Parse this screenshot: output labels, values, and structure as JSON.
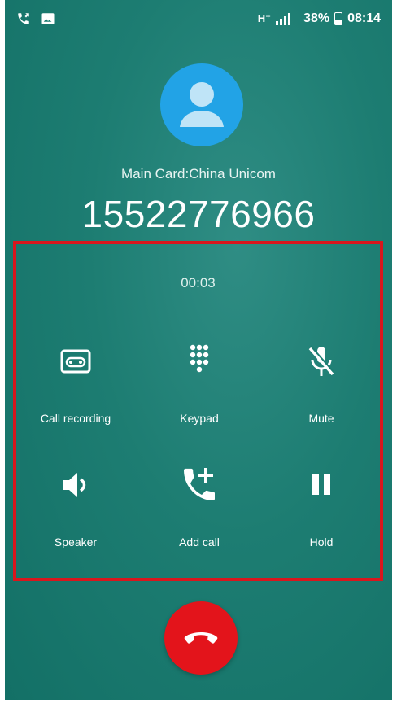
{
  "status_bar": {
    "network": "H⁺",
    "battery_percent": "38%",
    "time": "08:14"
  },
  "call": {
    "carrier": "Main Card:China Unicom",
    "number": "15522776966",
    "duration": "00:03"
  },
  "controls": [
    {
      "label": "Call recording",
      "icon": "call-recording-icon"
    },
    {
      "label": "Keypad",
      "icon": "keypad-icon"
    },
    {
      "label": "Mute",
      "icon": "mute-icon"
    },
    {
      "label": "Speaker",
      "icon": "speaker-icon"
    },
    {
      "label": "Add call",
      "icon": "add-call-icon"
    },
    {
      "label": "Hold",
      "icon": "hold-icon"
    }
  ],
  "colors": {
    "background": "#1d7d72",
    "avatar": "#22a3e6",
    "highlight_border": "#d9161d",
    "end_call": "#e3141b"
  }
}
